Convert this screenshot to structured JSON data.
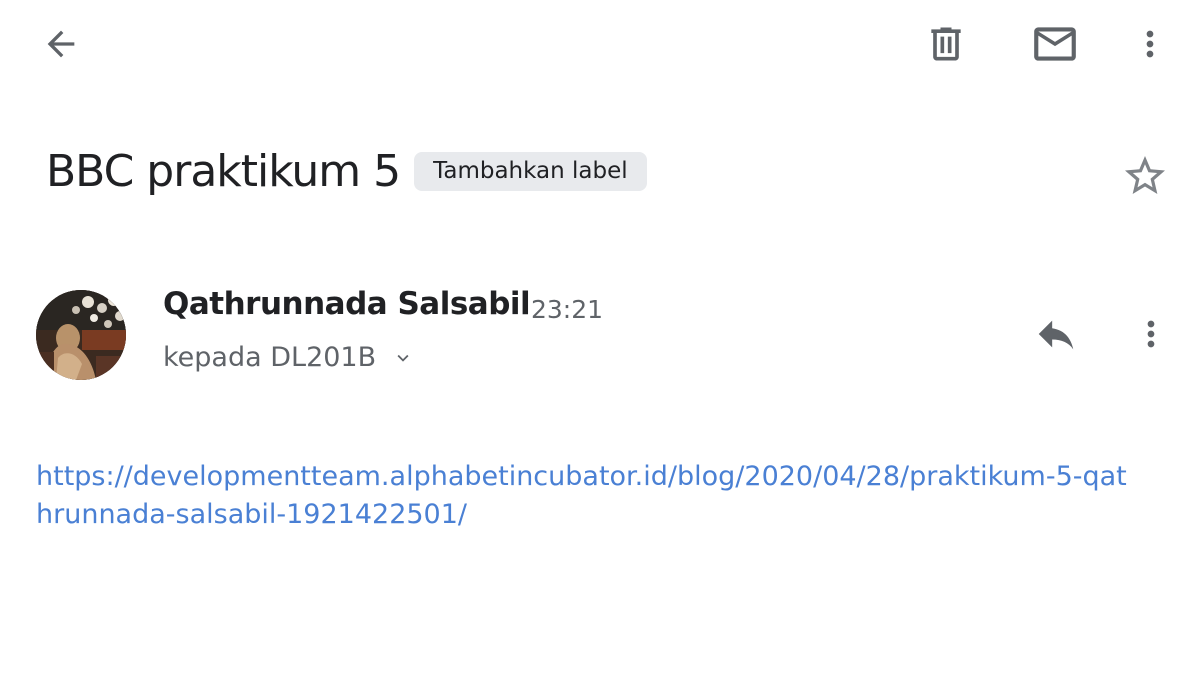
{
  "toolbar": {
    "back_icon": "arrow-back-icon",
    "delete_icon": "trash-icon",
    "mark_unread_icon": "mail-icon",
    "more_icon": "more-vert-icon"
  },
  "email": {
    "subject": "BBC praktikum 5",
    "label_chip": "Tambahkan label",
    "star_icon": "star-outline-icon",
    "sender_name": "Qathrunnada Salsabil",
    "time": "23:21",
    "recipient": "kepada DL201B",
    "body_link": "https://developmentteam.alphabetincubator.id/blog/2020/04/28/praktikum-5-qathrunnada-salsabil-1921422501/"
  },
  "colors": {
    "link": "#4a80d4",
    "icon": "#5f6368",
    "chip_bg": "#e8eaed"
  }
}
